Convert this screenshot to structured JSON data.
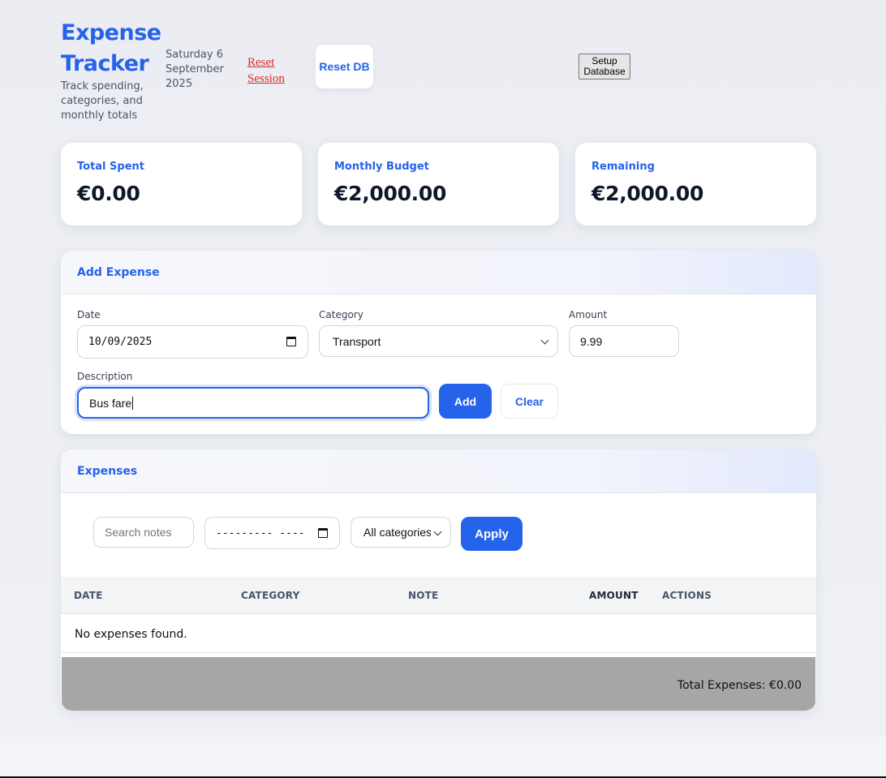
{
  "header": {
    "title": "Expense Tracker",
    "subtitle": "Track spending, categories, and monthly totals",
    "date": "Saturday 6 September 2025",
    "reset_session": "Reset Session",
    "reset_db": "Reset DB",
    "setup_db": "Setup Database"
  },
  "stats": {
    "total_spent": {
      "label": "Total Spent",
      "value": "€0.00"
    },
    "monthly_budget": {
      "label": "Monthly Budget",
      "value": "€2,000.00"
    },
    "remaining": {
      "label": "Remaining",
      "value": "€2,000.00"
    }
  },
  "add_expense": {
    "title": "Add Expense",
    "date_label": "Date",
    "date_value": "10/09/2025",
    "category_label": "Category",
    "category_value": "Transport",
    "amount_label": "Amount",
    "amount_value": "9.99",
    "description_label": "Description",
    "description_value": "Bus fare",
    "add_button": "Add",
    "clear_button": "Clear"
  },
  "expenses": {
    "title": "Expenses",
    "search_placeholder": "Search notes",
    "month_value": "--------- ----",
    "category_filter": "All categories",
    "apply_button": "Apply",
    "columns": [
      "DATE",
      "CATEGORY",
      "NOTE",
      "AMOUNT",
      "ACTIONS"
    ],
    "empty_message": "No expenses found.",
    "total_text": "Total Expenses: €0.00"
  },
  "colors": {
    "accent": "#2563eb",
    "danger": "#dc2626",
    "footer_bar": "#a6a6a6"
  }
}
